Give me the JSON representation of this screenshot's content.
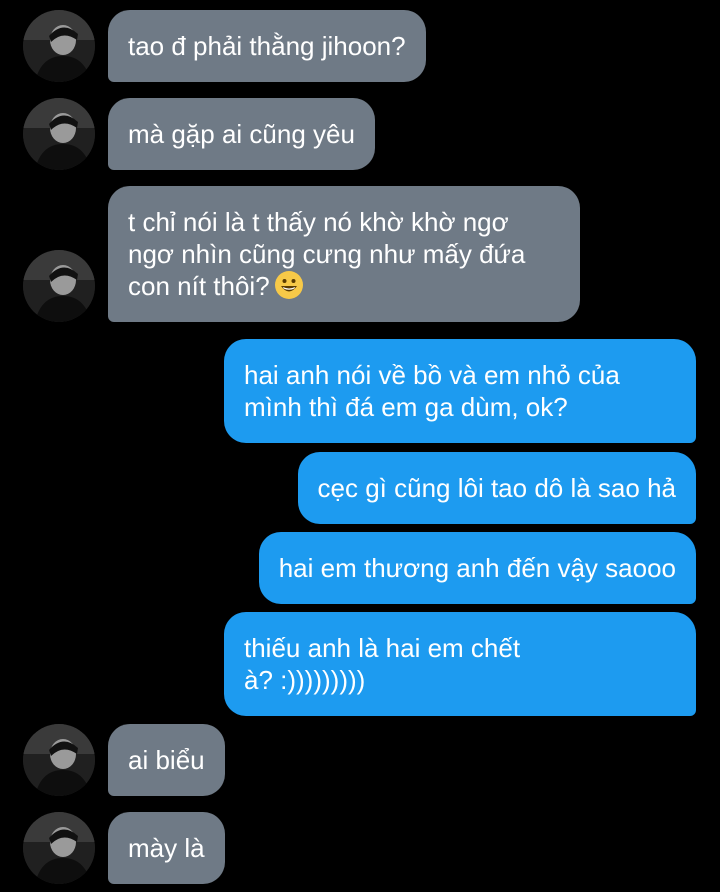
{
  "avatar_icon": "contact-avatar-photo",
  "colors": {
    "background": "#000000",
    "incoming_bubble": "#6f7a86",
    "outgoing_bubble": "#1d9bf0",
    "text": "#ffffff"
  },
  "messages": [
    {
      "direction": "incoming",
      "text": "tao đ phải thằng jihoon?"
    },
    {
      "direction": "incoming",
      "text": "mà gặp ai cũng yêu"
    },
    {
      "direction": "incoming",
      "text": "t chỉ nói là t thấy nó khờ khờ ngơ\nngơ nhìn cũng cưng như mấy đứa\ncon nít thôi?",
      "emoji": "grinning-face-emoji"
    },
    {
      "direction": "outgoing",
      "text": "hai anh nói về bồ và em nhỏ của\nmình thì đá em ga dùm, ok?"
    },
    {
      "direction": "outgoing",
      "text": "cẹc gì cũng lôi tao dô là sao hả"
    },
    {
      "direction": "outgoing",
      "text": "hai em thương anh đến vậy saooo"
    },
    {
      "direction": "outgoing",
      "text": "thiếu anh là hai em chết\nà? :)))))))))"
    },
    {
      "direction": "incoming",
      "text": "ai biểu"
    },
    {
      "direction": "incoming",
      "text": "mày là"
    }
  ]
}
